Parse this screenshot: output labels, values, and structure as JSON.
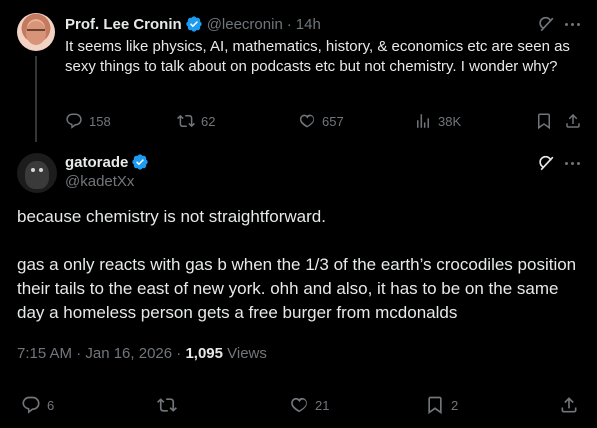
{
  "parent": {
    "name": "Prof. Lee Cronin",
    "handle": "@leecronin",
    "dot": "·",
    "time": "14h",
    "text": "It seems like physics, AI, mathematics, history, & economics etc are seen as sexy things to talk about on podcasts etc but not chemistry. I wonder why?",
    "replies": "158",
    "reposts": "62",
    "likes": "657",
    "views": "38K"
  },
  "reply": {
    "name": "gatorade",
    "handle": "@kadetXx",
    "para1": "because chemistry is not straightforward.",
    "para2": "gas a only reacts with gas b when the 1/3 of the earth’s crocodiles position their tails to the east of new york. ohh and also, it has to be on the same day a homeless person gets a free burger from mcdonalds",
    "timestamp": "7:15 AM · Jan 16, 2026 · ",
    "views_count": "1,095",
    "views_label": " Views",
    "replies": "6",
    "likes": "21",
    "bookmarks": "2"
  },
  "colors": {
    "background": "#000000",
    "text": "#e7e9ea",
    "muted": "#71767b",
    "verified": "#1d9bf0"
  },
  "icons": {
    "verified": "verified-badge-icon",
    "grok": "grok-icon",
    "more": "more-icon",
    "reply": "reply-icon",
    "repost": "repost-icon",
    "like": "like-icon",
    "views": "views-icon",
    "bookmark": "bookmark-icon",
    "share": "share-icon"
  }
}
